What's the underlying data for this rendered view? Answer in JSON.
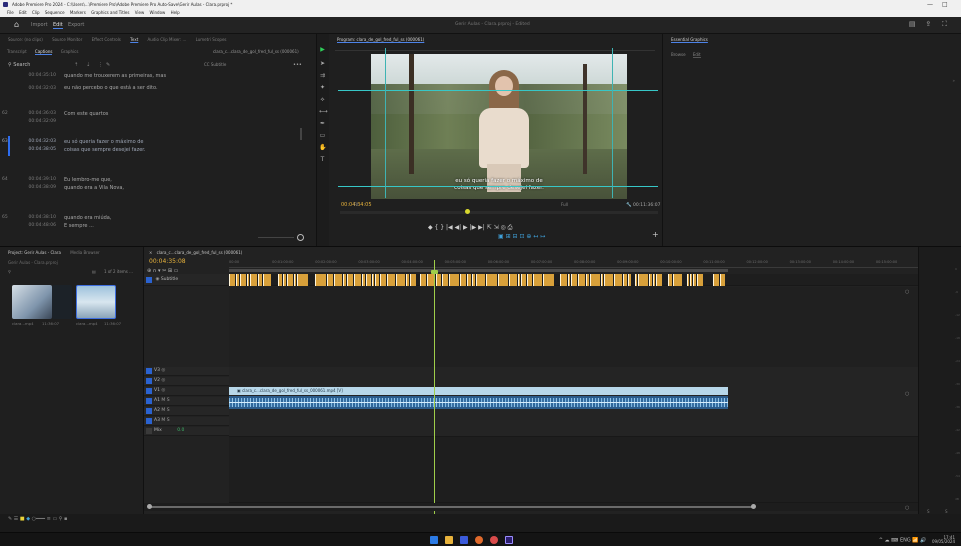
{
  "window": {
    "title": "Adobe Premiere Pro 2024 - C:\\Users\\...\\Premiere Pro\\Adobe Premiere Pro Auto-Save\\Gerir Aulas - Clara.prproj *",
    "controls": [
      "—",
      "□"
    ]
  },
  "menu": [
    "File",
    "Edit",
    "Clip",
    "Sequence",
    "Markers",
    "Graphics and Titles",
    "View",
    "Window",
    "Help"
  ],
  "workspace": {
    "tabs": [
      "Import",
      "Edit",
      "Export"
    ],
    "active": "Edit",
    "center_title": "Gerir Aulas - Clara.prproj - Edited"
  },
  "text_panel": {
    "tabs": [
      "Source: (no clips)",
      "Source Monitor",
      "Effect Controls",
      "Text",
      "Audio Clip Mixer: ...",
      "Lumetri Scopes"
    ],
    "active_tab": "Text",
    "sequence": "clara_c...clara_de_gol_fred_ful_ss (000061)",
    "subtabs": [
      "Transcript",
      "Captions",
      "Graphics"
    ],
    "active_subtab": "Captions",
    "search_label": "Search",
    "subtitle_track": "CC Subtitle",
    "more": "•••",
    "captions": [
      {
        "id": "partial",
        "tc_in": "00:04:35:10",
        "tc_out": "00:04:32:03",
        "text": "quando me trouxerem as primeiras, mas"
      },
      {
        "id": "0",
        "tc_in": "",
        "tc_out": "00:04:32:03",
        "text": "eu não percebo o que está a ser dito."
      },
      {
        "id": "62",
        "tc_in": "00:04:36:03",
        "tc_out": "00:04:32:09",
        "text": "Com este quartos"
      },
      {
        "id": "63",
        "tc_in": "00:04:32:03",
        "tc_out": "00:04:38:05",
        "text": "eu só queria fazer o máximo de"
      },
      {
        "id": "",
        "tc_in": "",
        "tc_out": "",
        "text": "coisas que sempre desejei fazer."
      },
      {
        "id": "64",
        "tc_in": "00:04:39:10",
        "tc_out": "00:04:38:09",
        "text": "Eu lembro-me que,"
      },
      {
        "id": "",
        "tc_in": "",
        "tc_out": "",
        "text": "quando era a Vila Nova,"
      },
      {
        "id": "65",
        "tc_in": "00:04:38:10",
        "tc_out": "00:04:48:06",
        "text": "quando era miúda,"
      },
      {
        "id": "",
        "tc_in": "",
        "tc_out": "",
        "text": "E sempre ..."
      }
    ]
  },
  "program": {
    "tab": "Program: clara_de_gol_fred_ful_ss (000061)",
    "subtitle_line1": "eu só queria fazer o máximo de",
    "subtitle_line2": "coisas que sempre desejei fazer.",
    "timecode": "00:04:34:05",
    "fit": "Fit",
    "quality": "Full",
    "duration": "00:11:36:07",
    "playhead_fraction": 0.4,
    "controls": "◆  {  }  |◀  ◀|  ▶  |▶  ▶|  ⇱  ⇲  ◎  ⎙",
    "controls2": "▣  ⊞  ⊟  ⊡  ⊕  ↤  ↦",
    "plus": "+"
  },
  "essential": {
    "tab": "Essential Graphics",
    "subtabs": [
      "Browse",
      "Edit"
    ],
    "active_subtab": "Edit"
  },
  "project": {
    "tabs": [
      "Project: Gerir Aulas - Clara",
      "Media Browser"
    ],
    "path": "Gerir Aulas - Clara.prproj",
    "items_label": "1 of 2 items ...",
    "items": [
      {
        "name": "clara...mp4",
        "duration": "11:36:07"
      },
      {
        "name": "clara...mp4",
        "duration": "11:36:07"
      }
    ]
  },
  "timeline": {
    "tab": "clara_c...clara_de_gol_fred_ful_ss (000061)",
    "timecode": "00:04:35:08",
    "ruler": [
      "00:00",
      "00:01:00:00",
      "00:02:00:00",
      "00:03:00:00",
      "00:04:00:00",
      "00:05:00:00",
      "00:06:00:00",
      "00:07:00:00",
      "00:08:00:00",
      "00:09:00:00",
      "00:10:00:00",
      "00:11:00:00",
      "00:12:00:00",
      "00:13:00:00",
      "00:14:00:00",
      "00:15:00:00"
    ],
    "tools": "⊕  ∩  ▾  ✂  ⊞  ▭",
    "subtitle_track_name": "Subtitle",
    "tracks": [
      {
        "name": "V3",
        "kind": "video"
      },
      {
        "name": "V2",
        "kind": "video"
      },
      {
        "name": "V1",
        "kind": "video"
      },
      {
        "name": "A1",
        "kind": "audio"
      },
      {
        "name": "A2",
        "kind": "audio"
      },
      {
        "name": "A3",
        "kind": "audio"
      },
      {
        "name": "Mix",
        "kind": "mix"
      }
    ],
    "mix_value": "0.0",
    "video_clip": "clara_c...clara_de_gol_fred_ful_ss_000061.mp4 [V]",
    "playhead_fraction": 0.41
  },
  "meters": {
    "labels": [
      "S",
      "S"
    ],
    "ticks": [
      "0",
      "-6",
      "-12",
      "-18",
      "-24",
      "-30",
      "-36",
      "-42",
      "-48",
      "-54",
      "dB"
    ]
  },
  "taskbar": {
    "time": "17:41",
    "date": "09/05/2024",
    "tray": "^  ☁  ⌨  ENG  📶  🔊"
  },
  "colors": {
    "accent": "#4d83e8",
    "timecode": "#e8b33c",
    "subtitle_clip": "#d8a03a",
    "audio_clip": "#2b5b8a",
    "video_clip": "#b7d7e9",
    "playhead": "#9fce4a"
  }
}
